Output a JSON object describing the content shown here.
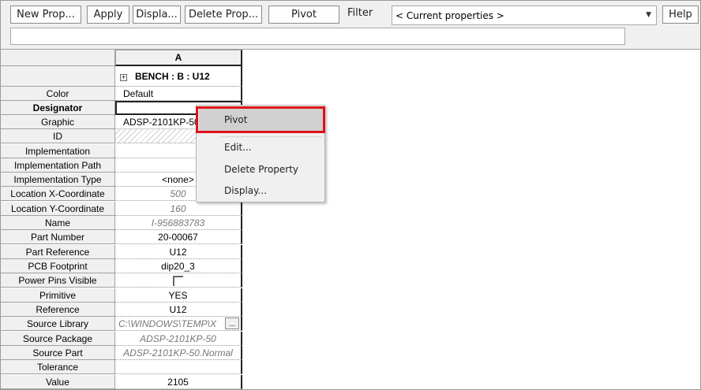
{
  "toolbar": {
    "new_prop": "New Prop...",
    "apply": "Apply",
    "display": "Displa...",
    "delete_prop": "Delete Prop...",
    "pivot": "Pivot",
    "filter_label": "Filter",
    "filter_value": "< Current properties >",
    "help": "Help",
    "edit_value": ""
  },
  "grid": {
    "column_header": "A",
    "part_title": "BENCH : B : U12",
    "rows": [
      {
        "label": "Color",
        "value": "Default"
      },
      {
        "label": "Designator",
        "value": ""
      },
      {
        "label": "Graphic",
        "value": "ADSP-2101KP-50"
      },
      {
        "label": "ID",
        "value": ""
      },
      {
        "label": "Implementation",
        "value": ""
      },
      {
        "label": "Implementation Path",
        "value": ""
      },
      {
        "label": "Implementation Type",
        "value": "<none>"
      },
      {
        "label": "Location X-Coordinate",
        "value": "500"
      },
      {
        "label": "Location Y-Coordinate",
        "value": "160"
      },
      {
        "label": "Name",
        "value": "I-956883783"
      },
      {
        "label": "Part Number",
        "value": "20-00067"
      },
      {
        "label": "Part Reference",
        "value": "U12"
      },
      {
        "label": "PCB Footprint",
        "value": "dip20_3"
      },
      {
        "label": "Power Pins Visible",
        "value": ""
      },
      {
        "label": "Primitive",
        "value": "YES"
      },
      {
        "label": "Reference",
        "value": "U12"
      },
      {
        "label": "Source Library",
        "value": "C:\\WINDOWS\\TEMP\\X"
      },
      {
        "label": "Source Package",
        "value": "ADSP-2101KP-50"
      },
      {
        "label": "Source Part",
        "value": "ADSP-2101KP-50.Normal"
      },
      {
        "label": "Tolerance",
        "value": ""
      },
      {
        "label": "Value",
        "value": "2105"
      }
    ],
    "browse_label": "..."
  },
  "context_menu": {
    "items": [
      "Pivot",
      "Edit...",
      "Delete Property",
      "Display..."
    ]
  },
  "colors": {
    "highlight": "#e0101a",
    "menu_bg": "#f0f0f0",
    "menu_hover": "#d0d0d0"
  }
}
